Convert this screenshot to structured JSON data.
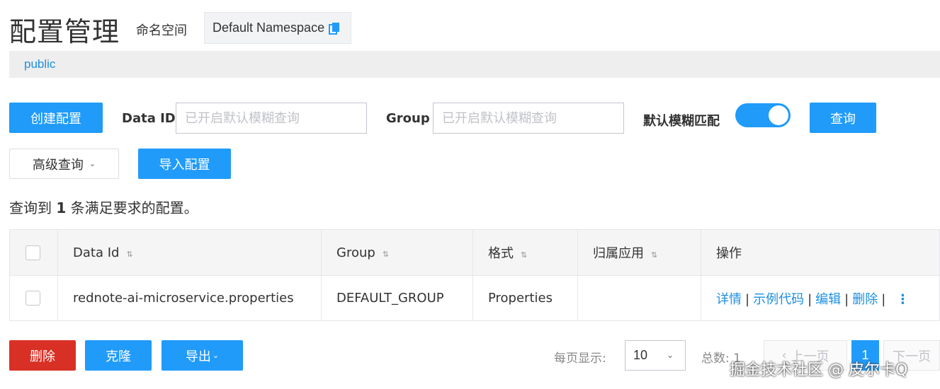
{
  "header": {
    "title": "配置管理",
    "namespace_label": "命名空间",
    "namespace_value": "Default Namespace"
  },
  "namespace_bar": {
    "current": "public"
  },
  "search": {
    "create_button": "创建配置",
    "data_id_label": "Data ID",
    "data_id_placeholder": "已开启默认模糊查询",
    "group_label": "Group",
    "group_placeholder": "已开启默认模糊查询",
    "fuzzy_label": "默认模糊匹配",
    "fuzzy_enabled": true,
    "query_button": "查询",
    "advanced_button": "高级查询",
    "import_button": "导入配置"
  },
  "result": {
    "prefix": "查询到",
    "count": "1",
    "suffix": "条满足要求的配置。"
  },
  "table": {
    "headers": [
      "Data Id",
      "Group",
      "格式",
      "归属应用",
      "操作"
    ],
    "rows": [
      {
        "data_id": "rednote-ai-microservice.properties",
        "group": "DEFAULT_GROUP",
        "format": "Properties",
        "app": "",
        "actions": [
          "详情",
          "示例代码",
          "编辑",
          "删除"
        ]
      }
    ]
  },
  "footer": {
    "delete_button": "删除",
    "clone_button": "克隆",
    "export_button": "导出",
    "page_size_label": "每页显示:",
    "page_size": "10",
    "total_label": "总数:",
    "total": "1",
    "prev": "上一页",
    "current_page": "1",
    "next": "下一页"
  },
  "watermark": "掘金技术社区 @ 皮尔卡Q",
  "colors": {
    "primary": "#209bfa",
    "danger": "#d93026",
    "link": "#1c8fe0"
  }
}
